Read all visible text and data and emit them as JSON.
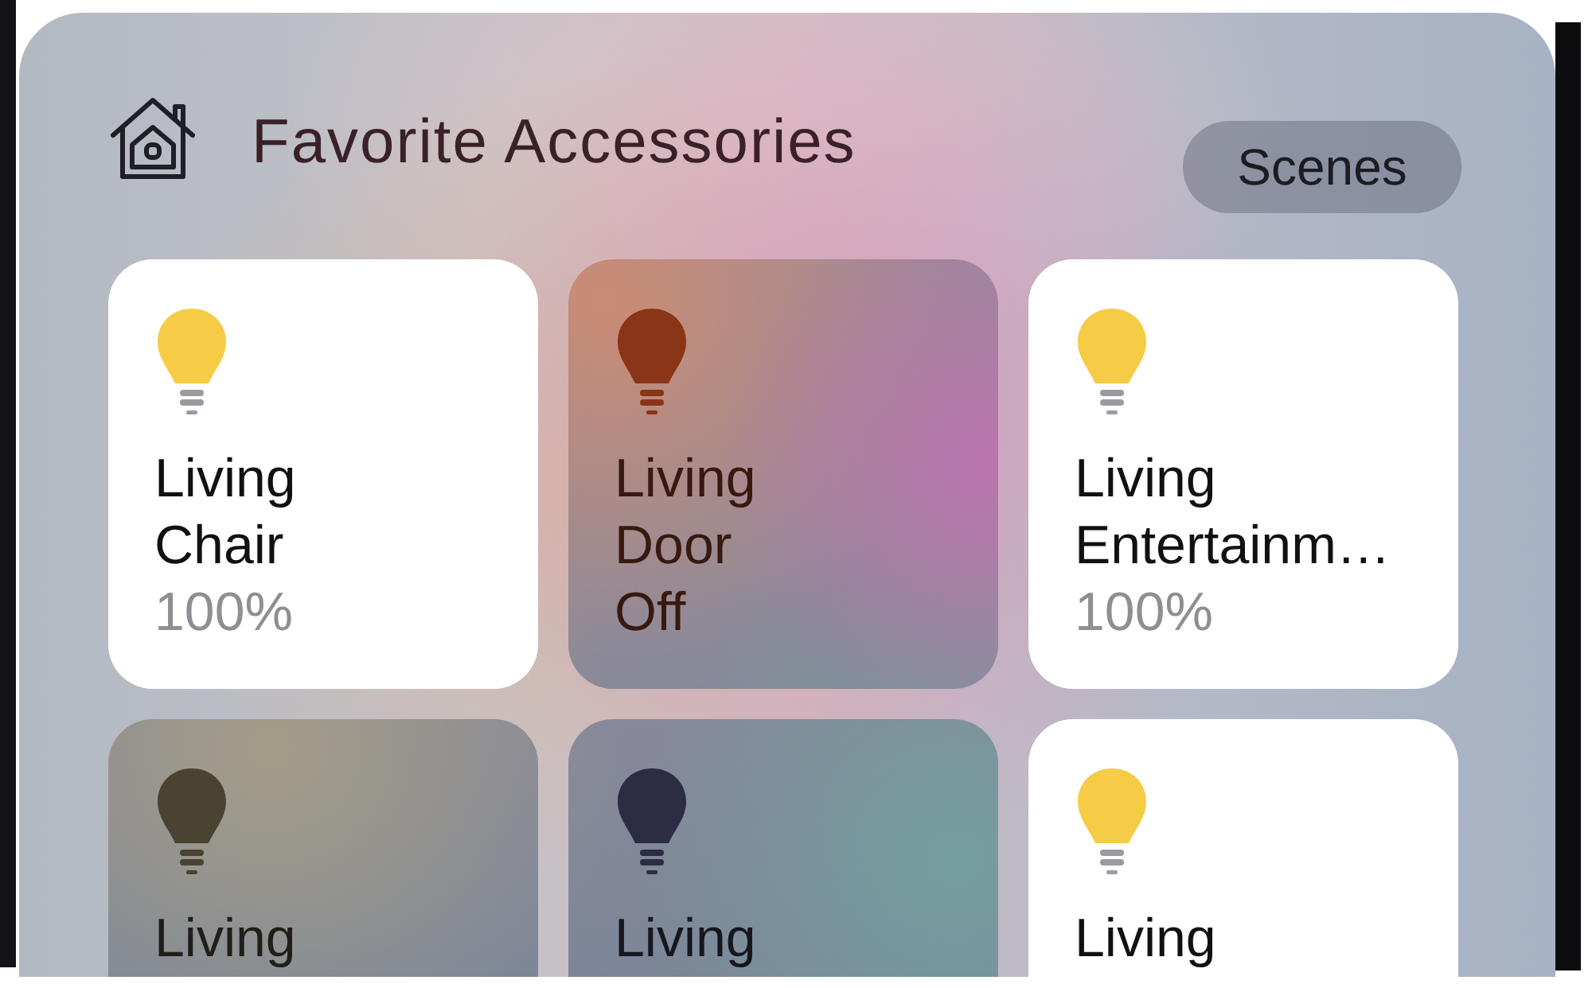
{
  "header": {
    "title": "Favorite Accessories",
    "scenes_button": "Scenes"
  },
  "accessories": [
    {
      "room": "Living",
      "name": "Chair",
      "status": "100%",
      "on": true,
      "color": "#f6cb45"
    },
    {
      "room": "Living",
      "name": "Door",
      "status": "Off",
      "on": false,
      "color": "#8a3518"
    },
    {
      "room": "Living",
      "name": "Entertainm…",
      "status": "100%",
      "on": true,
      "color": "#f6cb45"
    },
    {
      "room": "Living",
      "on": false,
      "color": "#4a4332"
    },
    {
      "room": "Living",
      "on": false,
      "color": "#2c2c44"
    },
    {
      "room": "Living",
      "on": true,
      "color": "#f6cb45"
    }
  ]
}
